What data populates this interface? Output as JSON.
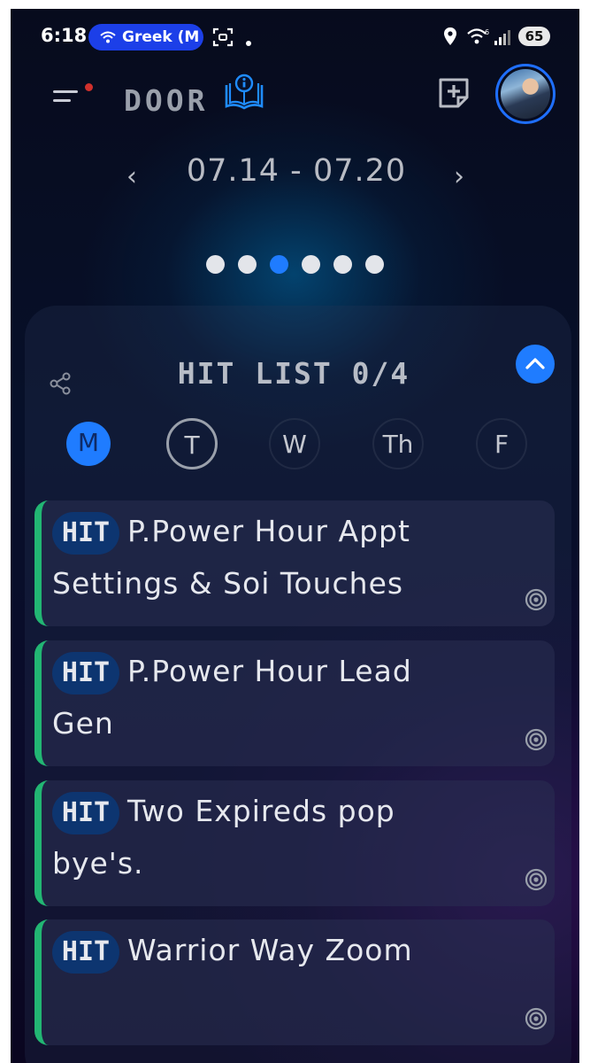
{
  "status_bar": {
    "time": "6:18",
    "pill_label": "Greek (M",
    "battery": "65"
  },
  "header": {
    "title": "DOOR"
  },
  "week": {
    "range": "07.14 - 07.20",
    "prev_label": "‹",
    "next_label": "›",
    "page_count": 6,
    "active_page_index": 2
  },
  "hit_list": {
    "title": "HIT LIST 0/4",
    "days": [
      {
        "label": "M",
        "state": "active"
      },
      {
        "label": "T",
        "state": "today"
      },
      {
        "label": "W",
        "state": "normal"
      },
      {
        "label": "Th",
        "state": "normal"
      },
      {
        "label": "F",
        "state": "normal"
      }
    ],
    "tasks": [
      {
        "tag": "HIT",
        "line1": "P.Power Hour Appt",
        "line2": "Settings & Soi Touches"
      },
      {
        "tag": "HIT",
        "line1": "P.Power Hour Lead",
        "line2": "Gen"
      },
      {
        "tag": "HIT",
        "line1": "Two Expireds pop",
        "line2": "bye's."
      },
      {
        "tag": "HIT",
        "line1": "Warrior Way Zoom",
        "line2": ""
      }
    ]
  },
  "colors": {
    "accent": "#1f7cff",
    "task_border": "#22b673",
    "tag_bg": "#0d3570",
    "notification_dot": "#d0302c"
  },
  "icons": {
    "menu": "hamburger-menu-icon",
    "book": "info-book-icon",
    "add": "add-note-icon",
    "share": "share-icon",
    "collapse": "chevron-up-icon",
    "target": "target-icon"
  }
}
